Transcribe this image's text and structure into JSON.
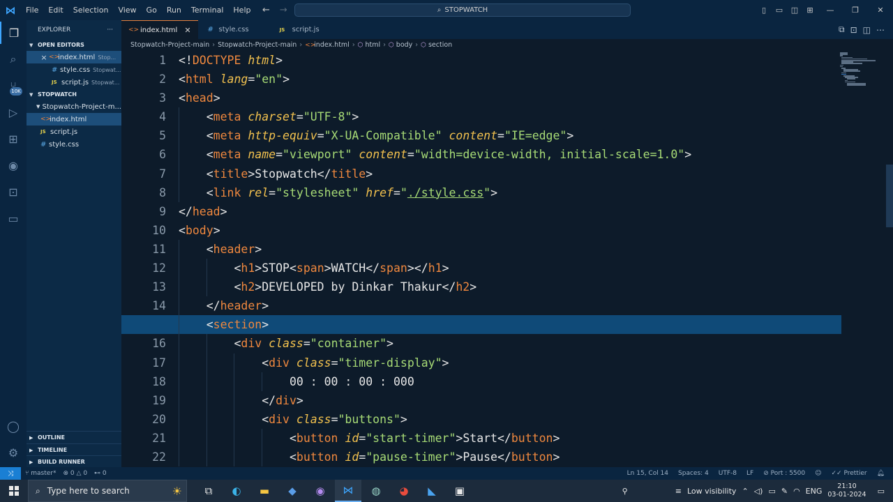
{
  "window": {
    "menu": [
      "File",
      "Edit",
      "Selection",
      "View",
      "Go",
      "Run",
      "Terminal",
      "Help"
    ],
    "search_title": "STOPWATCH"
  },
  "sidebar": {
    "title": "EXPLORER",
    "more": "···",
    "open_editors_label": "OPEN EDITORS",
    "open_editors": [
      {
        "name": "index.html",
        "hint": "Stop...",
        "type": "html",
        "closable": true
      },
      {
        "name": "style.css",
        "hint": "Stopwat...",
        "type": "css",
        "closable": false
      },
      {
        "name": "script.js",
        "hint": "Stopwat...",
        "type": "js",
        "closable": false
      }
    ],
    "workspace_label": "STOPWATCH",
    "folder": "Stopwatch-Project-m...",
    "files": [
      {
        "name": "index.html",
        "type": "html",
        "selected": true
      },
      {
        "name": "script.js",
        "type": "js",
        "selected": false
      },
      {
        "name": "style.css",
        "type": "css",
        "selected": false
      }
    ],
    "outline_label": "OUTLINE",
    "timeline_label": "TIMELINE",
    "build_runner_label": "BUILD RUNNER"
  },
  "activity_badge": "10K",
  "tabs": [
    {
      "name": "index.html",
      "type": "html",
      "active": true
    },
    {
      "name": "style.css",
      "type": "css",
      "active": false
    },
    {
      "name": "script.js",
      "type": "js",
      "active": false
    }
  ],
  "breadcrumb": [
    "Stopwatch-Project-main",
    "Stopwatch-Project-main",
    "index.html",
    "html",
    "body",
    "section"
  ],
  "code": {
    "current_line": 15,
    "lines": [
      [
        [
          "t",
          "<!"
        ],
        [
          "tag",
          "DOCTYPE"
        ],
        [
          "t",
          " "
        ],
        [
          "attr",
          "html"
        ],
        [
          "t",
          ">"
        ]
      ],
      [
        [
          "t",
          "<"
        ],
        [
          "tag",
          "html"
        ],
        [
          "t",
          " "
        ],
        [
          "attr",
          "lang"
        ],
        [
          "t",
          "="
        ],
        [
          "str",
          "\"en\""
        ],
        [
          "t",
          ">"
        ]
      ],
      [
        [
          "t",
          "<"
        ],
        [
          "tag",
          "head"
        ],
        [
          "t",
          ">"
        ]
      ],
      [
        [
          "t",
          "    <"
        ],
        [
          "tag",
          "meta"
        ],
        [
          "t",
          " "
        ],
        [
          "attr",
          "charset"
        ],
        [
          "t",
          "="
        ],
        [
          "str",
          "\"UTF-8\""
        ],
        [
          "t",
          ">"
        ]
      ],
      [
        [
          "t",
          "    <"
        ],
        [
          "tag",
          "meta"
        ],
        [
          "t",
          " "
        ],
        [
          "attr",
          "http-equiv"
        ],
        [
          "t",
          "="
        ],
        [
          "str",
          "\"X-UA-Compatible\""
        ],
        [
          "t",
          " "
        ],
        [
          "attr",
          "content"
        ],
        [
          "t",
          "="
        ],
        [
          "str",
          "\"IE=edge\""
        ],
        [
          "t",
          ">"
        ]
      ],
      [
        [
          "t",
          "    <"
        ],
        [
          "tag",
          "meta"
        ],
        [
          "t",
          " "
        ],
        [
          "attr",
          "name"
        ],
        [
          "t",
          "="
        ],
        [
          "str",
          "\"viewport\""
        ],
        [
          "t",
          " "
        ],
        [
          "attr",
          "content"
        ],
        [
          "t",
          "="
        ],
        [
          "str",
          "\"width=device-width, initial-scale=1.0\""
        ],
        [
          "t",
          ">"
        ]
      ],
      [
        [
          "t",
          "    <"
        ],
        [
          "tag",
          "title"
        ],
        [
          "t",
          ">Stopwatch</"
        ],
        [
          "tag",
          "title"
        ],
        [
          "t",
          ">"
        ]
      ],
      [
        [
          "t",
          "    <"
        ],
        [
          "tag",
          "link"
        ],
        [
          "t",
          " "
        ],
        [
          "attr",
          "rel"
        ],
        [
          "t",
          "="
        ],
        [
          "str",
          "\"stylesheet\""
        ],
        [
          "t",
          " "
        ],
        [
          "attr",
          "href"
        ],
        [
          "t",
          "="
        ],
        [
          "str",
          "\""
        ],
        [
          "link",
          "./style.css"
        ],
        [
          "str",
          "\""
        ],
        [
          "t",
          ">"
        ]
      ],
      [
        [
          "t",
          "</"
        ],
        [
          "tag",
          "head"
        ],
        [
          "t",
          ">"
        ]
      ],
      [
        [
          "t",
          "<"
        ],
        [
          "tag",
          "body"
        ],
        [
          "t",
          ">"
        ]
      ],
      [
        [
          "t",
          "    <"
        ],
        [
          "tag",
          "header"
        ],
        [
          "t",
          ">"
        ]
      ],
      [
        [
          "t",
          "        <"
        ],
        [
          "tag",
          "h1"
        ],
        [
          "t",
          ">STOP<"
        ],
        [
          "tag",
          "span"
        ],
        [
          "t",
          ">WATCH</"
        ],
        [
          "tag",
          "span"
        ],
        [
          "t",
          "></"
        ],
        [
          "tag",
          "h1"
        ],
        [
          "t",
          ">"
        ]
      ],
      [
        [
          "t",
          "        <"
        ],
        [
          "tag",
          "h2"
        ],
        [
          "t",
          ">DEVELOPED by Dinkar Thakur</"
        ],
        [
          "tag",
          "h2"
        ],
        [
          "t",
          ">"
        ]
      ],
      [
        [
          "t",
          "    </"
        ],
        [
          "tag",
          "header"
        ],
        [
          "t",
          ">"
        ]
      ],
      [
        [
          "t",
          "    <"
        ],
        [
          "tag",
          "section"
        ],
        [
          "t",
          ">"
        ]
      ],
      [
        [
          "t",
          "        <"
        ],
        [
          "tag",
          "div"
        ],
        [
          "t",
          " "
        ],
        [
          "attr",
          "class"
        ],
        [
          "t",
          "="
        ],
        [
          "str",
          "\"container\""
        ],
        [
          "t",
          ">"
        ]
      ],
      [
        [
          "t",
          "            <"
        ],
        [
          "tag",
          "div"
        ],
        [
          "t",
          " "
        ],
        [
          "attr",
          "class"
        ],
        [
          "t",
          "="
        ],
        [
          "str",
          "\"timer-display\""
        ],
        [
          "t",
          ">"
        ]
      ],
      [
        [
          "t",
          "                00 : 00 : 00 : 000"
        ]
      ],
      [
        [
          "t",
          "            </"
        ],
        [
          "tag",
          "div"
        ],
        [
          "t",
          ">"
        ]
      ],
      [
        [
          "t",
          "            <"
        ],
        [
          "tag",
          "div"
        ],
        [
          "t",
          " "
        ],
        [
          "attr",
          "class"
        ],
        [
          "t",
          "="
        ],
        [
          "str",
          "\"buttons\""
        ],
        [
          "t",
          ">"
        ]
      ],
      [
        [
          "t",
          "                <"
        ],
        [
          "tag",
          "button"
        ],
        [
          "t",
          " "
        ],
        [
          "attr",
          "id"
        ],
        [
          "t",
          "="
        ],
        [
          "str",
          "\"start-timer\""
        ],
        [
          "t",
          ">Start</"
        ],
        [
          "tag",
          "button"
        ],
        [
          "t",
          ">"
        ]
      ],
      [
        [
          "t",
          "                <"
        ],
        [
          "tag",
          "button"
        ],
        [
          "t",
          " "
        ],
        [
          "attr",
          "id"
        ],
        [
          "t",
          "="
        ],
        [
          "str",
          "\"pause-timer\""
        ],
        [
          "t",
          ">Pause</"
        ],
        [
          "tag",
          "button"
        ],
        [
          "t",
          ">"
        ]
      ]
    ]
  },
  "status": {
    "branch": "master*",
    "errors": "0",
    "warnings": "0",
    "ports": "0",
    "position": "Ln 15, Col 14",
    "spaces": "Spaces: 4",
    "encoding": "UTF-8",
    "eol": "LF",
    "port": "Port : 5500",
    "prettier": "Prettier"
  },
  "taskbar": {
    "search_placeholder": "Type here to search",
    "visibility": "Low visibility",
    "language": "ENG",
    "time": "21:10",
    "date": "03-01-2024"
  }
}
